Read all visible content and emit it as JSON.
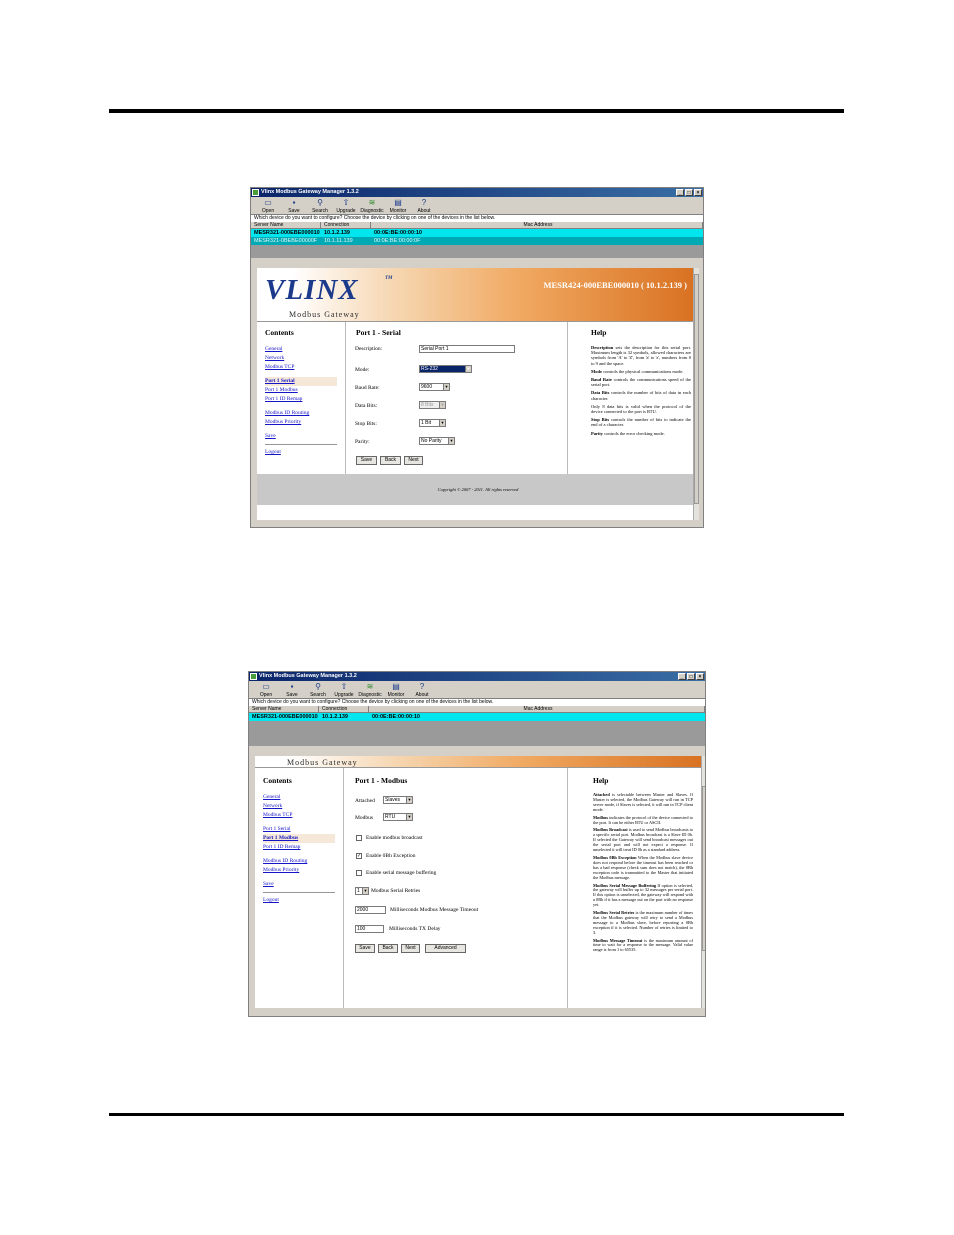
{
  "app_title": "Vlinx Modbus Gateway Manager 1.3.2",
  "toolbar": [
    {
      "label": "Open",
      "icon": "folder-icon"
    },
    {
      "label": "Save",
      "icon": "floppy-icon"
    },
    {
      "label": "Search",
      "icon": "search-icon"
    },
    {
      "label": "Upgrade",
      "icon": "upgrade-icon"
    },
    {
      "label": "Diagnostic",
      "icon": "diagnostic-icon"
    },
    {
      "label": "Monitor",
      "icon": "monitor-icon"
    },
    {
      "label": "About",
      "icon": "help-icon"
    }
  ],
  "prompt": "Which device do you want to configure? Choose the device by clicking on one of the devices in the list below.",
  "columns": [
    "Server Name",
    "Connection",
    "Mac Address"
  ],
  "brand": {
    "logo": "VLINX",
    "tm": "TM",
    "subtitle": "Modbus Gateway"
  },
  "nav": {
    "heading": "Contents",
    "links": [
      "General",
      "Network",
      "Modbus TCP",
      "Port 1 Serial",
      "Port 1 Modbus",
      "Port 1 ID Remap",
      "Modbus ID Routing",
      "Modbus Priority",
      "Save",
      "Logout"
    ]
  },
  "help_heading": "Help",
  "screen1": {
    "devices": [
      {
        "name": "MESR321-000EBE000010",
        "connection": "10.1.2.139",
        "mac": "00:0E:BE:00:00:10"
      },
      {
        "name": "MESR321-0BEBE00000F",
        "connection": "10.1.11.139",
        "mac": "00:0E:BE:00:00:0F"
      }
    ],
    "device_title": "MESR424-000EBE000010 ( 10.1.2.139 )",
    "section_title": "Port 1 - Serial",
    "fields": {
      "description_label": "Description:",
      "description_value": "Serial Port 1",
      "mode_label": "Mode:",
      "mode_value": "RS-232",
      "baud_label": "Baud Rate:",
      "baud_value": "9600",
      "databits_label": "Data Bits:",
      "databits_value": "8 Bits",
      "stopbits_label": "Stop Bits:",
      "stopbits_value": "1 Bit",
      "parity_label": "Parity:",
      "parity_value": "No Parity"
    },
    "buttons": [
      "Save",
      "Back",
      "Next"
    ],
    "help": [
      {
        "term": "Description",
        "text": "sets the description for this serial port. Maximum length is 32 symbols, allowed characters are symbols from 'A' to 'Z', from 'a' to 'z', numbers from 0 to 9 and the space."
      },
      {
        "term": "Mode",
        "text": "controls the physical communications mode."
      },
      {
        "term": "Baud Rate",
        "text": "controls the communications speed of the serial port."
      },
      {
        "term": "Data Bits",
        "text": "controls the number of bits of data in each character."
      },
      {
        "term": "",
        "text": "Only 8 data bits is valid when the protocol of the device connected to the port is RTU."
      },
      {
        "term": "Stop Bits",
        "text": "controls the number of bits to indicate the end of a character."
      },
      {
        "term": "Parity",
        "text": "controls the error checking mode."
      }
    ],
    "footer": "Copyright © 2007 - 2011. All rights reserved"
  },
  "screen2": {
    "devices": [
      {
        "name": "MESR321-000EBE000010",
        "connection": "10.1.2.139",
        "mac": "00:0E:BE:00:00:10"
      }
    ],
    "section_title": "Port 1 - Modbus",
    "attached_label": "Attached",
    "attached_value": "Slaves",
    "modbus_label": "Modbus",
    "modbus_value": "RTU",
    "checks": [
      {
        "label": "Enable modbus broadcast",
        "checked": false
      },
      {
        "label": "Enable 0Bh Exception",
        "checked": true
      },
      {
        "label": "Enable serial message buffering",
        "checked": false
      }
    ],
    "retries_value": "1",
    "retries_label": "Modbus Serial Retries",
    "timeout_value": "2000",
    "timeout_label": "Milliseconds Modbus Message Timeout",
    "txdelay_value": "100",
    "txdelay_label": "Milliseconds TX Delay",
    "buttons": [
      "Save",
      "Back",
      "Next",
      "Advanced"
    ],
    "help": [
      {
        "term": "Attached",
        "text": "is selectable between Master and Slaves. If Master is selected, the Modbus Gateway will run in TCP server mode, if Slaves is selected, it will run in TCP client mode."
      },
      {
        "term": "Modbus",
        "text": "indicates the protocol of the device connected to the port. It can be either RTU or ASCII."
      },
      {
        "term": "Modbus Broadcast",
        "text": "is used to send Modbus broadcasts to a specific serial port. Modbus broadcast is a Slave ID 0h. If selected the Gateway will send broadcast messages out the serial port and will not expect a response. If unselected it will treat ID 0h as a standard address."
      },
      {
        "term": "Modbus 0Bh Exception",
        "text": "When the Modbus slave device does not respond before the timeout has been reached or has a bad response (check sum does not match), the 0Bh exception code is transmitted to the Master that initiated the Modbus message."
      },
      {
        "term": "Modbus Serial Message Buffering",
        "text": "If option is selected, the gateway will buffer up to 32 messages per serial port. If this option is unselected, the gateway will respond with a 0Bh if it has a message out on the port with no response yet."
      },
      {
        "term": "Modbus Serial Retries",
        "text": "is the maximum number of times that the Modbus gateway will retry to send a Modbus message to a Modbus slave, before reporting a 0Bh exception if it is selected. Number of retries is limited to 3."
      },
      {
        "term": "Modbus Message Timeout",
        "text": "is the maximum amount of time to wait for a response to the message. Valid value range is from 1 to 65535."
      }
    ]
  }
}
